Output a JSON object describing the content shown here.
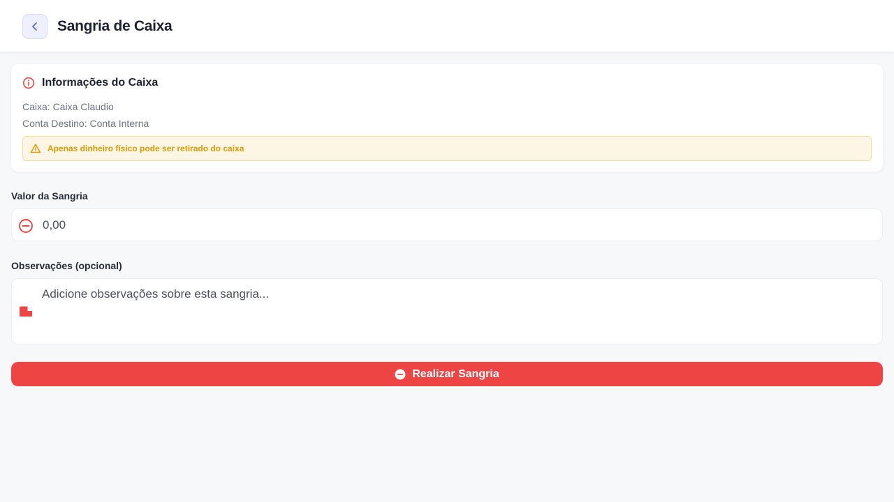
{
  "header": {
    "title": "Sangria de Caixa",
    "back_icon": "chevron-left-icon"
  },
  "info": {
    "title": "Informações do Caixa",
    "caixa_line": "Caixa: Caixa Claudio",
    "conta_line": "Conta Destino: Conta Interna",
    "warning": "Apenas dinheiro físico pode ser retirado do caixa"
  },
  "form": {
    "valor_label": "Valor da Sangria",
    "valor_placeholder": "0,00",
    "obs_label": "Observações (opcional)",
    "obs_placeholder": "Adicione observações sobre esta sangria..."
  },
  "submit": {
    "label": "Realizar Sangria"
  },
  "colors": {
    "accent": "#ef4444",
    "warning": "#d99a06",
    "back_button": "#5b6ad0"
  }
}
